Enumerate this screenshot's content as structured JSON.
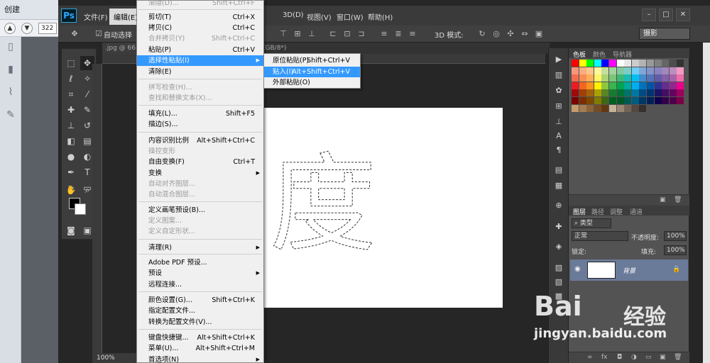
{
  "viewer": {
    "create_label": "创建",
    "page_number": "322"
  },
  "ps": {
    "logo": "Ps",
    "menus": [
      "文件(F)",
      "编辑(E)",
      "3D(D)",
      "视图(V)",
      "窗口(W)",
      "帮助(H)"
    ],
    "options_auto_select": "自动选择",
    "options_3d_mode": "3D 模式:",
    "workspace": "摄影",
    "doc_tab": ".jpg @ 66.7",
    "doc_tab_right": "(GB/8*)",
    "zoom": "100%",
    "canvas_glyph": "度"
  },
  "edit_menu": {
    "top_cut_off": "渐隐(D)...",
    "top_cut_off_shortcut": "Shift+Ctrl+F",
    "items": [
      {
        "label": "剪切(T)",
        "shortcut": "Ctrl+X"
      },
      {
        "label": "拷贝(C)",
        "shortcut": "Ctrl+C"
      },
      {
        "label": "合并拷贝(Y)",
        "shortcut": "Shift+Ctrl+C"
      },
      {
        "label": "粘贴(P)",
        "shortcut": "Ctrl+V"
      },
      {
        "label": "选择性粘贴(I)",
        "shortcut": ""
      },
      {
        "label": "清除(E)",
        "shortcut": ""
      },
      {
        "label": "拼写检查(H)...",
        "shortcut": ""
      },
      {
        "label": "查找和替换文本(X)...",
        "shortcut": ""
      },
      {
        "label": "填充(L)...",
        "shortcut": "Shift+F5"
      },
      {
        "label": "描边(S)...",
        "shortcut": ""
      },
      {
        "label": "内容识别比例",
        "shortcut": "Alt+Shift+Ctrl+C"
      },
      {
        "label": "操控变形",
        "shortcut": ""
      },
      {
        "label": "自由变换(F)",
        "shortcut": "Ctrl+T"
      },
      {
        "label": "变换",
        "shortcut": ""
      },
      {
        "label": "自动对齐图层...",
        "shortcut": ""
      },
      {
        "label": "自动混合图层...",
        "shortcut": ""
      },
      {
        "label": "定义画笔预设(B)...",
        "shortcut": ""
      },
      {
        "label": "定义图案...",
        "shortcut": ""
      },
      {
        "label": "定义自定形状...",
        "shortcut": ""
      },
      {
        "label": "清理(R)",
        "shortcut": ""
      },
      {
        "label": "Adobe PDF 预设...",
        "shortcut": ""
      },
      {
        "label": "预设",
        "shortcut": ""
      },
      {
        "label": "远程连接...",
        "shortcut": ""
      },
      {
        "label": "颜色设置(G)...",
        "shortcut": "Shift+Ctrl+K"
      },
      {
        "label": "指定配置文件...",
        "shortcut": ""
      },
      {
        "label": "转换为配置文件(V)...",
        "shortcut": ""
      },
      {
        "label": "键盘快捷键...",
        "shortcut": "Alt+Shift+Ctrl+K"
      },
      {
        "label": "菜单(U)...",
        "shortcut": "Alt+Shift+Ctrl+M"
      },
      {
        "label": "首选项(N)",
        "shortcut": ""
      }
    ]
  },
  "paste_special_submenu": {
    "items": [
      {
        "label": "原位粘贴(P)",
        "shortcut": "Shift+Ctrl+V"
      },
      {
        "label": "贴入(I)",
        "shortcut": "Alt+Shift+Ctrl+V"
      },
      {
        "label": "外部粘贴(O)",
        "shortcut": ""
      }
    ]
  },
  "panels": {
    "color_tabs": [
      "色板",
      "颜色",
      "导航器"
    ],
    "layer_tabs": [
      "图层",
      "路径",
      "调整",
      "通道"
    ],
    "kind_label": "类型",
    "blend_mode": "正常",
    "opacity_label": "不透明度:",
    "opacity_value": "100%",
    "lock_label": "锁定:",
    "fill_label": "填充:",
    "fill_value": "100%",
    "layer_name": "背景"
  },
  "watermark": {
    "brand": "Bai",
    "brand_cn": "经验",
    "url": "jingyan.baidu.com"
  }
}
